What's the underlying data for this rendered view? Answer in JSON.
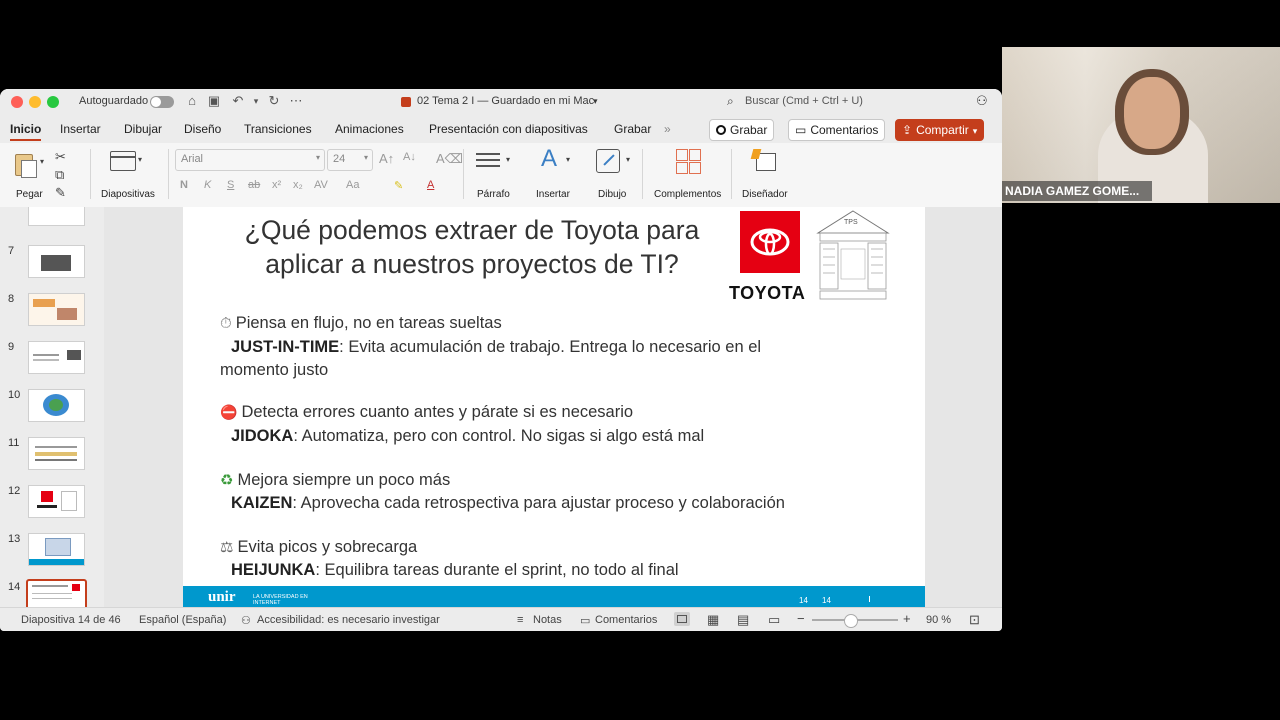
{
  "titlebar": {
    "autosave_label": "Autoguardado",
    "doc_title": "02 Tema 2 I — Guardado en mi Mac",
    "search_placeholder": "Buscar (Cmd + Ctrl + U)"
  },
  "tabs": [
    "Inicio",
    "Insertar",
    "Dibujar",
    "Diseño",
    "Transiciones",
    "Animaciones",
    "Presentación con diapositivas",
    "Grabar"
  ],
  "tab_overflow": "»",
  "actions": {
    "record": "Grabar",
    "comments": "Comentarios",
    "share": "Compartir"
  },
  "ribbon": {
    "paste": "Pegar",
    "slides": "Diapositivas",
    "font_name": "Arial",
    "font_size": "24",
    "paragraph": "Párrafo",
    "insert": "Insertar",
    "draw": "Dibujo",
    "addins": "Complementos",
    "designer": "Diseñador",
    "format_letters": [
      "N",
      "K",
      "S",
      "ab",
      "x²",
      "x₂"
    ]
  },
  "thumbnails": [
    {
      "num": "7"
    },
    {
      "num": "8"
    },
    {
      "num": "9"
    },
    {
      "num": "10"
    },
    {
      "num": "11"
    },
    {
      "num": "12"
    },
    {
      "num": "13"
    },
    {
      "num": "14"
    }
  ],
  "slide": {
    "title_line1": "¿Qué podemos extraer de Toyota para",
    "title_line2": "aplicar a nuestros proyectos de TI?",
    "logo_text": "TOYOTA",
    "house_label": "TPS",
    "items": [
      {
        "icon": "⏱",
        "heading": "Piensa en flujo, no en tareas sueltas",
        "term": "JUST-IN-TIME",
        "desc": ": Evita acumulación de trabajo. Entrega lo necesario en el",
        "desc2": "momento justo"
      },
      {
        "icon": "⛔",
        "heading": "Detecta errores cuanto antes y párate si es necesario",
        "term": "JIDOKA",
        "desc": ": Automatiza, pero con control. No sigas si algo está mal"
      },
      {
        "icon": "♻",
        "heading": "Mejora siempre un poco más",
        "term": "KAIZEN",
        "desc": ": Aprovecha cada retrospectiva para ajustar proceso y colaboración"
      },
      {
        "icon": "⚖",
        "heading": "Evita picos y sobrecarga",
        "term": "HEIJUNKA",
        "desc": ": Equilibra tareas durante el sprint, no todo al final"
      }
    ],
    "footer_brand": "unir",
    "footer_tagline": "LA UNIVERSIDAD EN INTERNET",
    "footer_num1": "14",
    "footer_num2": "14"
  },
  "status": {
    "slide_count": "Diapositiva 14 de 46",
    "language": "Español (España)",
    "accessibility": "Accesibilidad: es necesario investigar",
    "notes": "Notas",
    "comments": "Comentarios",
    "zoom": "90 %"
  },
  "webcam": {
    "name": "NADIA GAMEZ GOME..."
  },
  "colors": {
    "accent": "#c43e1c",
    "toyota_red": "#e50012",
    "unir_blue": "#0098cd"
  }
}
